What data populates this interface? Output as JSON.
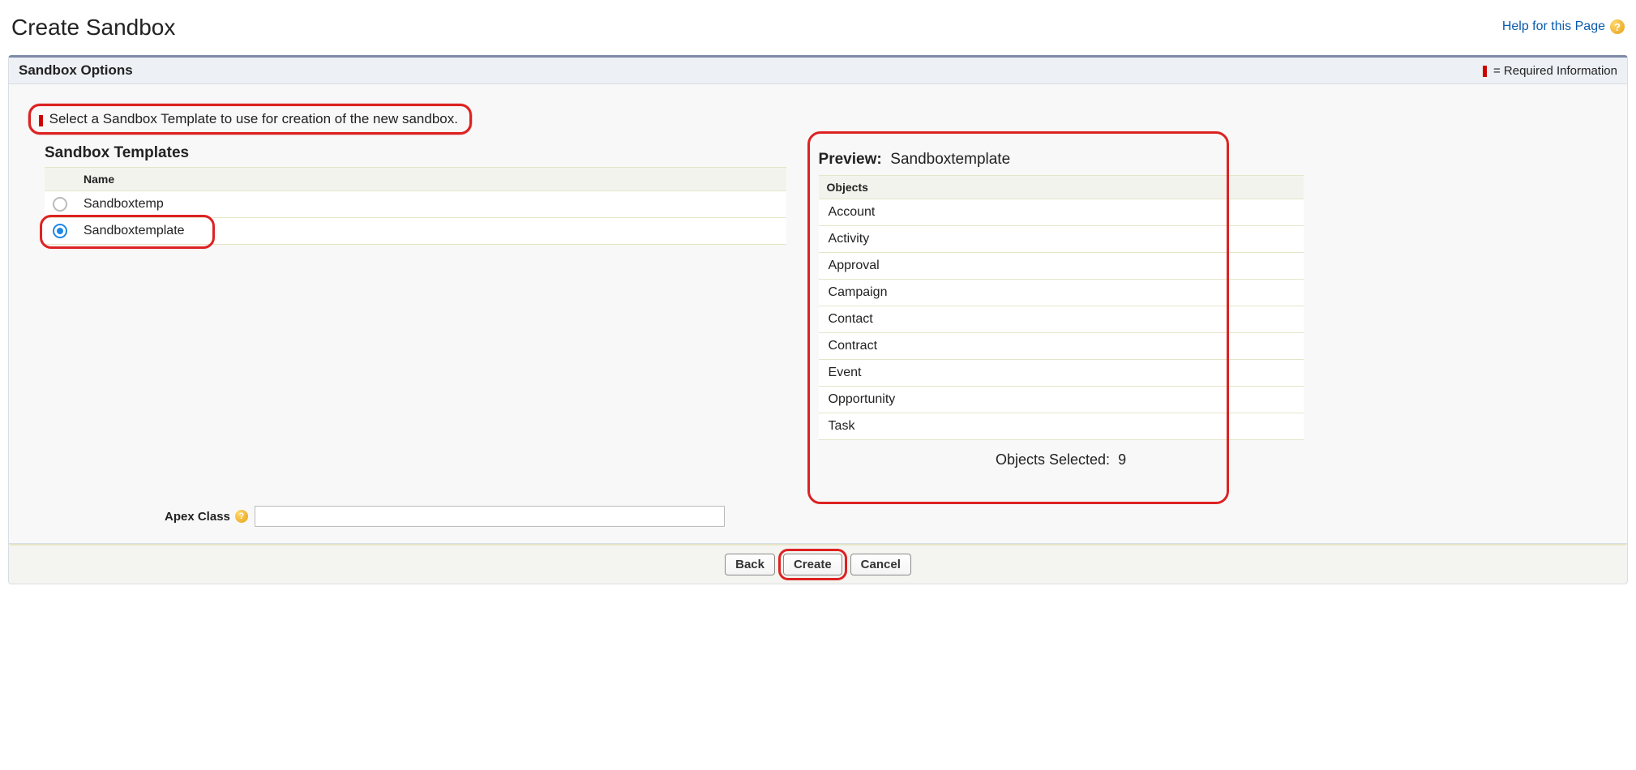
{
  "header": {
    "title": "Create Sandbox",
    "help_link": "Help for this Page"
  },
  "section": {
    "title": "Sandbox Options",
    "required_info": "= Required Information"
  },
  "instruction": "Select a Sandbox Template to use for creation of the new sandbox.",
  "templates": {
    "heading": "Sandbox Templates",
    "name_col": "Name",
    "rows": [
      {
        "name": "Sandboxtemp",
        "selected": false
      },
      {
        "name": "Sandboxtemplate",
        "selected": true
      }
    ]
  },
  "preview": {
    "label": "Preview:",
    "name": "Sandboxtemplate",
    "objects_col": "Objects",
    "objects": [
      "Account",
      "Activity",
      "Approval",
      "Campaign",
      "Contact",
      "Contract",
      "Event",
      "Opportunity",
      "Task"
    ],
    "selected_label": "Objects Selected:",
    "selected_count": "9"
  },
  "apex": {
    "label": "Apex Class",
    "value": ""
  },
  "buttons": {
    "back": "Back",
    "create": "Create",
    "cancel": "Cancel"
  }
}
